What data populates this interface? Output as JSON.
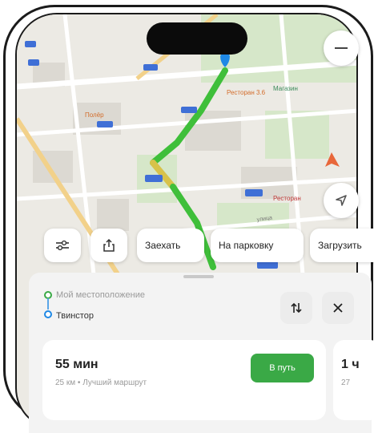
{
  "map": {
    "labels": {
      "poi_1": "Полёр",
      "poi_2": "Ресторан 3.6",
      "poi_3": "Магазин",
      "poi_4": "Ресторан",
      "poi_5": "Улица",
      "street": "улица"
    }
  },
  "chips": {
    "items": [
      "Заехать",
      "На парковку",
      "Загрузить"
    ]
  },
  "route": {
    "from": "Мой местоположение",
    "to": "Твинстор"
  },
  "card_main": {
    "time": "55 мин",
    "meta": "25 км • Лучший маршрут",
    "go_label": "В путь"
  },
  "card_peek": {
    "time": "1 ч",
    "meta": "27"
  },
  "colors": {
    "route_green": "#3fbf3a",
    "route_yellow": "#d8c24a",
    "accent_blue": "#1e88e5",
    "go_green": "#3aa946"
  }
}
